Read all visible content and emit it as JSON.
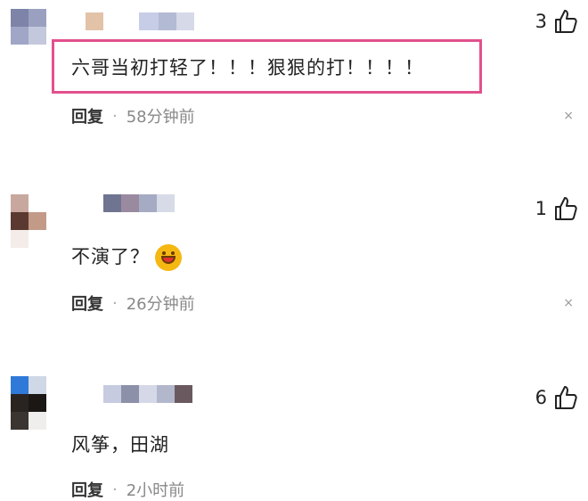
{
  "comments": [
    {
      "text": "六哥当初打轻了！！！狠狠的打！！！！",
      "reply": "回复",
      "dot": "·",
      "time": "58分钟前",
      "likes": "3",
      "close": "×",
      "highlighted": true
    },
    {
      "text": "不演了？",
      "emoji": "grinning-face",
      "reply": "回复",
      "dot": "·",
      "time": "26分钟前",
      "likes": "1",
      "close": "×"
    },
    {
      "text": "风筝，田湖",
      "reply": "回复",
      "dot": "·",
      "time": "2小时前",
      "likes": "6",
      "close": ""
    }
  ],
  "colors": {
    "highlight_border": "#e2508c",
    "meta_text": "#888888"
  }
}
